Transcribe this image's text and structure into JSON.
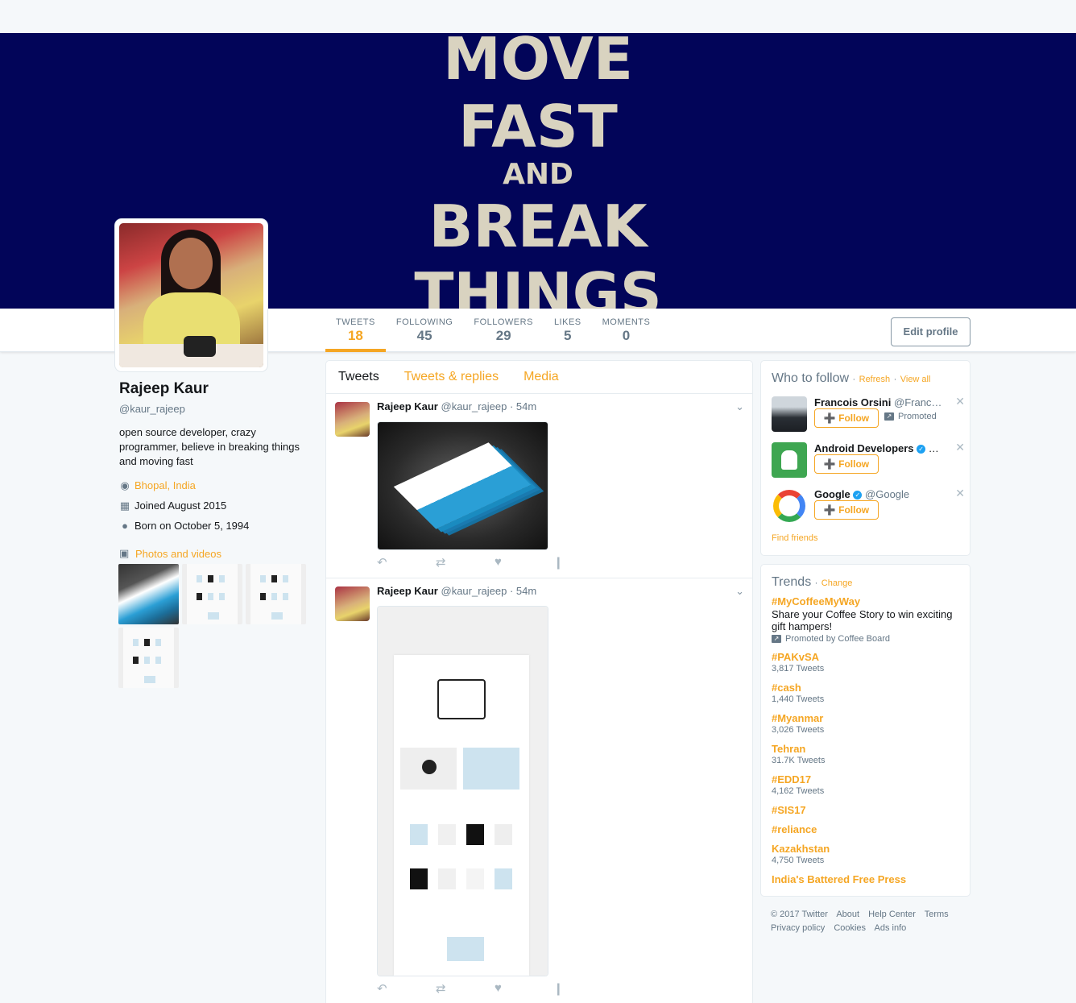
{
  "banner": {
    "lines": [
      "MOVE",
      "FAST",
      "AND",
      "BREAK",
      "THINGS"
    ]
  },
  "stats": [
    {
      "label": "TWEETS",
      "value": "18"
    },
    {
      "label": "FOLLOWING",
      "value": "45"
    },
    {
      "label": "FOLLOWERS",
      "value": "29"
    },
    {
      "label": "LIKES",
      "value": "5"
    },
    {
      "label": "MOMENTS",
      "value": "0"
    }
  ],
  "edit_profile_label": "Edit profile",
  "profile": {
    "name": "Rajeep Kaur",
    "handle": "@kaur_rajeep",
    "bio": "open source developer, crazy programmer, believe in breaking things and moving fast",
    "location": "Bhopal, India",
    "joined": "Joined August 2015",
    "born": "Born on October 5, 1994",
    "photos_label": "Photos and videos"
  },
  "tabs": [
    "Tweets",
    "Tweets & replies",
    "Media"
  ],
  "tweets": [
    {
      "name": "Rajeep Kaur",
      "handle": "@kaur_rajeep",
      "time": "· 54m"
    },
    {
      "name": "Rajeep Kaur",
      "handle": "@kaur_rajeep",
      "time": "· 54m"
    }
  ],
  "who_to_follow": {
    "title": "Who to follow",
    "sep": "·",
    "refresh": "Refresh",
    "view_all": "View all",
    "follow_label": "Follow",
    "items": [
      {
        "name": "Francois Orsini",
        "handle": "@Franc…",
        "promoted": "Promoted"
      },
      {
        "name": "Android Developers",
        "handle": "@…"
      },
      {
        "name": "Google",
        "handle": "@Google"
      }
    ],
    "find_friends": "Find friends"
  },
  "trends": {
    "title": "Trends",
    "sep": "·",
    "change": "Change",
    "items": [
      {
        "name": "#MyCoffeeMyWay",
        "desc": "Share your Coffee Story to win exciting gift hampers!",
        "promoted": "Promoted by Coffee Board"
      },
      {
        "name": "#PAKvSA",
        "count": "3,817 Tweets"
      },
      {
        "name": "#cash",
        "count": "1,440 Tweets"
      },
      {
        "name": "#Myanmar",
        "count": "3,026 Tweets"
      },
      {
        "name": "Tehran",
        "count": "31.7K Tweets"
      },
      {
        "name": "#EDD17",
        "count": "4,162 Tweets"
      },
      {
        "name": "#SIS17"
      },
      {
        "name": "#reliance"
      },
      {
        "name": "Kazakhstan",
        "count": "4,750 Tweets"
      },
      {
        "name": "India's Battered Free Press"
      }
    ]
  },
  "footer": {
    "line1": [
      "© 2017 Twitter",
      "About",
      "Help Center",
      "Terms"
    ],
    "line2": [
      "Privacy policy",
      "Cookies",
      "Ads info"
    ]
  },
  "colors": {
    "accent": "#f5a623",
    "banner": "#020559",
    "banner_text": "#d9d3c0"
  }
}
